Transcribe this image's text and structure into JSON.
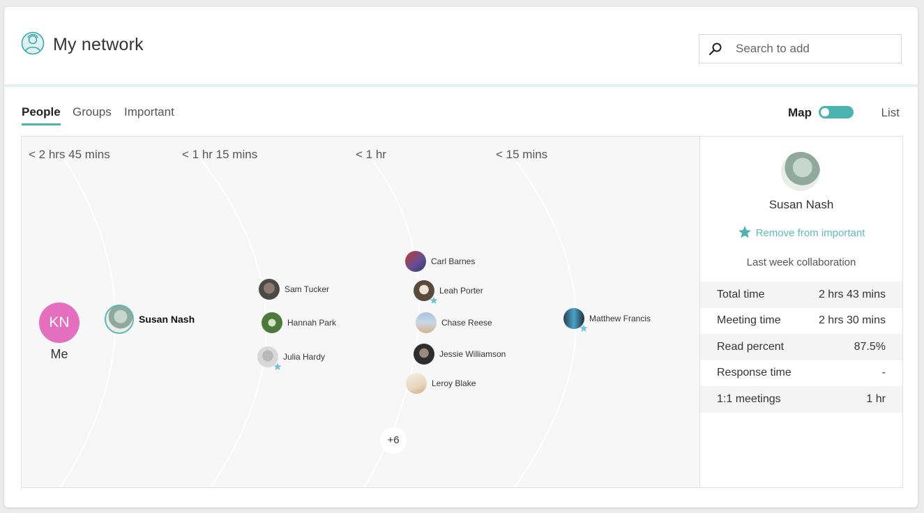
{
  "header": {
    "title": "My network",
    "search_placeholder": "Search to add",
    "search_value": ""
  },
  "tabs": [
    {
      "label": "People",
      "active": true
    },
    {
      "label": "Groups",
      "active": false
    },
    {
      "label": "Important",
      "active": false
    }
  ],
  "view_toggle": {
    "map_label": "Map",
    "list_label": "List",
    "selected": "Map"
  },
  "rings": [
    {
      "label": "< 2 hrs 45 mins"
    },
    {
      "label": "< 1 hr 15 mins"
    },
    {
      "label": "< 1 hr"
    },
    {
      "label": "< 15 mins"
    }
  ],
  "me": {
    "initials": "KN",
    "label": "Me"
  },
  "people": [
    {
      "name": "Susan Nash",
      "selected": true,
      "important": false
    },
    {
      "name": "Sam Tucker",
      "important": false
    },
    {
      "name": "Hannah Park",
      "important": false
    },
    {
      "name": "Julia Hardy",
      "important": true
    },
    {
      "name": "Carl Barnes",
      "important": false
    },
    {
      "name": "Leah Porter",
      "important": true
    },
    {
      "name": "Chase Reese",
      "important": false
    },
    {
      "name": "Jessie Williamson",
      "important": false
    },
    {
      "name": "Leroy Blake",
      "important": false
    },
    {
      "name": "Matthew Francis",
      "important": true
    }
  ],
  "more_count": "+6",
  "detail": {
    "name": "Susan Nash",
    "action": "Remove from important",
    "subtitle": "Last week collaboration",
    "stats": [
      {
        "label": "Total time",
        "value": "2 hrs 43 mins"
      },
      {
        "label": "Meeting time",
        "value": "2 hrs 30 mins"
      },
      {
        "label": "Read percent",
        "value": "87.5%"
      },
      {
        "label": "Response time",
        "value": "-"
      },
      {
        "label": "1:1 meetings",
        "value": "1 hr"
      }
    ]
  },
  "colors": {
    "accent": "#4bb3b0",
    "star": "#5cbcc0",
    "me_avatar": "#e46fbf"
  },
  "icons": {
    "app": "network-person-icon",
    "search": "search-icon",
    "star": "star-icon"
  }
}
